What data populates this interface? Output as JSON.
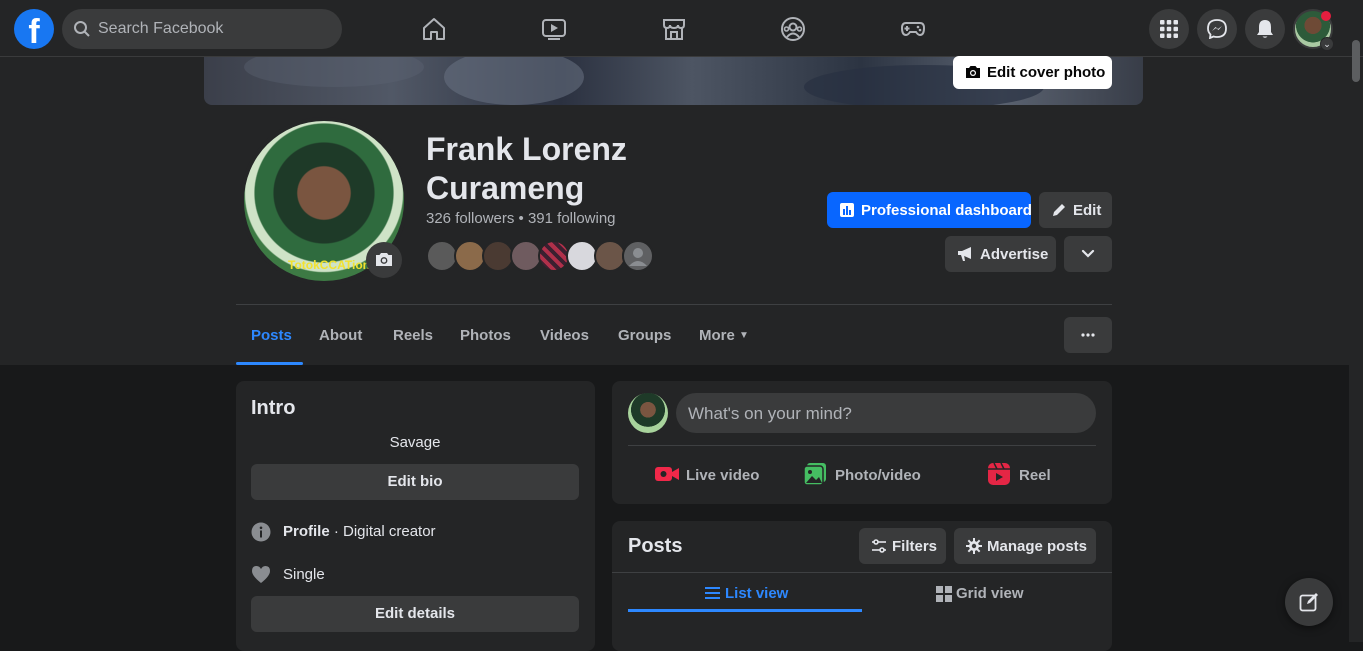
{
  "topbar": {
    "logo": "f",
    "search_placeholder": "Search Facebook",
    "nav_icons": [
      "home-icon",
      "watch-icon",
      "marketplace-icon",
      "groups-icon",
      "gaming-icon"
    ],
    "right_icons": [
      "menu-grid-icon",
      "messenger-icon",
      "notifications-icon"
    ]
  },
  "cover": {
    "edit_label": "Edit cover photo"
  },
  "profile": {
    "name": "Frank Lorenz Curameng",
    "followers_text": "326 followers • 391 following",
    "pfp_caption": "TotokCCATions",
    "friend_count_shown": 8
  },
  "actions": {
    "dashboard": "Professional dashboard",
    "edit": "Edit",
    "advertise": "Advertise"
  },
  "tabs": [
    "Posts",
    "About",
    "Reels",
    "Photos",
    "Videos",
    "Groups",
    "More"
  ],
  "intro": {
    "title": "Intro",
    "bio": "Savage",
    "edit_bio": "Edit bio",
    "profile_bold": "Profile",
    "profile_rest": " · Digital creator",
    "relationship": "Single",
    "edit_details": "Edit details"
  },
  "composer": {
    "placeholder": "What's on your mind?",
    "live": "Live video",
    "photo": "Photo/video",
    "reel": "Reel"
  },
  "posts": {
    "title": "Posts",
    "filters": "Filters",
    "manage": "Manage posts",
    "list_view": "List view",
    "grid_view": "Grid view"
  },
  "colors": {
    "accent": "#0866ff",
    "link": "#2d88ff",
    "surface": "#242526",
    "background": "#18191a"
  }
}
